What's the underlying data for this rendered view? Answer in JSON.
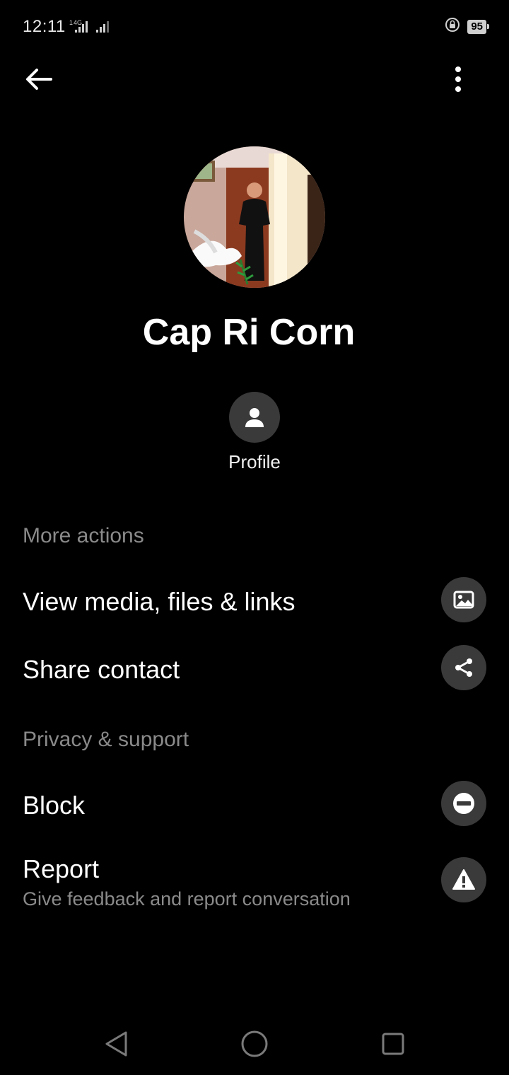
{
  "status_bar": {
    "time": "12:11",
    "network": "4G",
    "battery": "95",
    "icons": [
      "signal-icon",
      "rotation-lock-icon",
      "battery-icon"
    ]
  },
  "header": {
    "back_icon": "arrow-left-icon",
    "more_icon": "more-vertical-icon"
  },
  "contact": {
    "name": "Cap Ri Corn",
    "profile_label": "Profile"
  },
  "sections": {
    "more_actions": {
      "title": "More actions",
      "items": [
        {
          "label": "View media, files & links",
          "icon": "image-icon"
        },
        {
          "label": "Share contact",
          "icon": "share-icon"
        }
      ]
    },
    "privacy": {
      "title": "Privacy & support",
      "items": [
        {
          "label": "Block",
          "icon": "block-icon"
        },
        {
          "label": "Report",
          "sublabel": "Give feedback and report conversation",
          "icon": "warning-icon"
        }
      ]
    }
  },
  "colors": {
    "background": "#000000",
    "icon_circle": "#3a3a3a",
    "secondary_text": "#8a8a8a"
  }
}
